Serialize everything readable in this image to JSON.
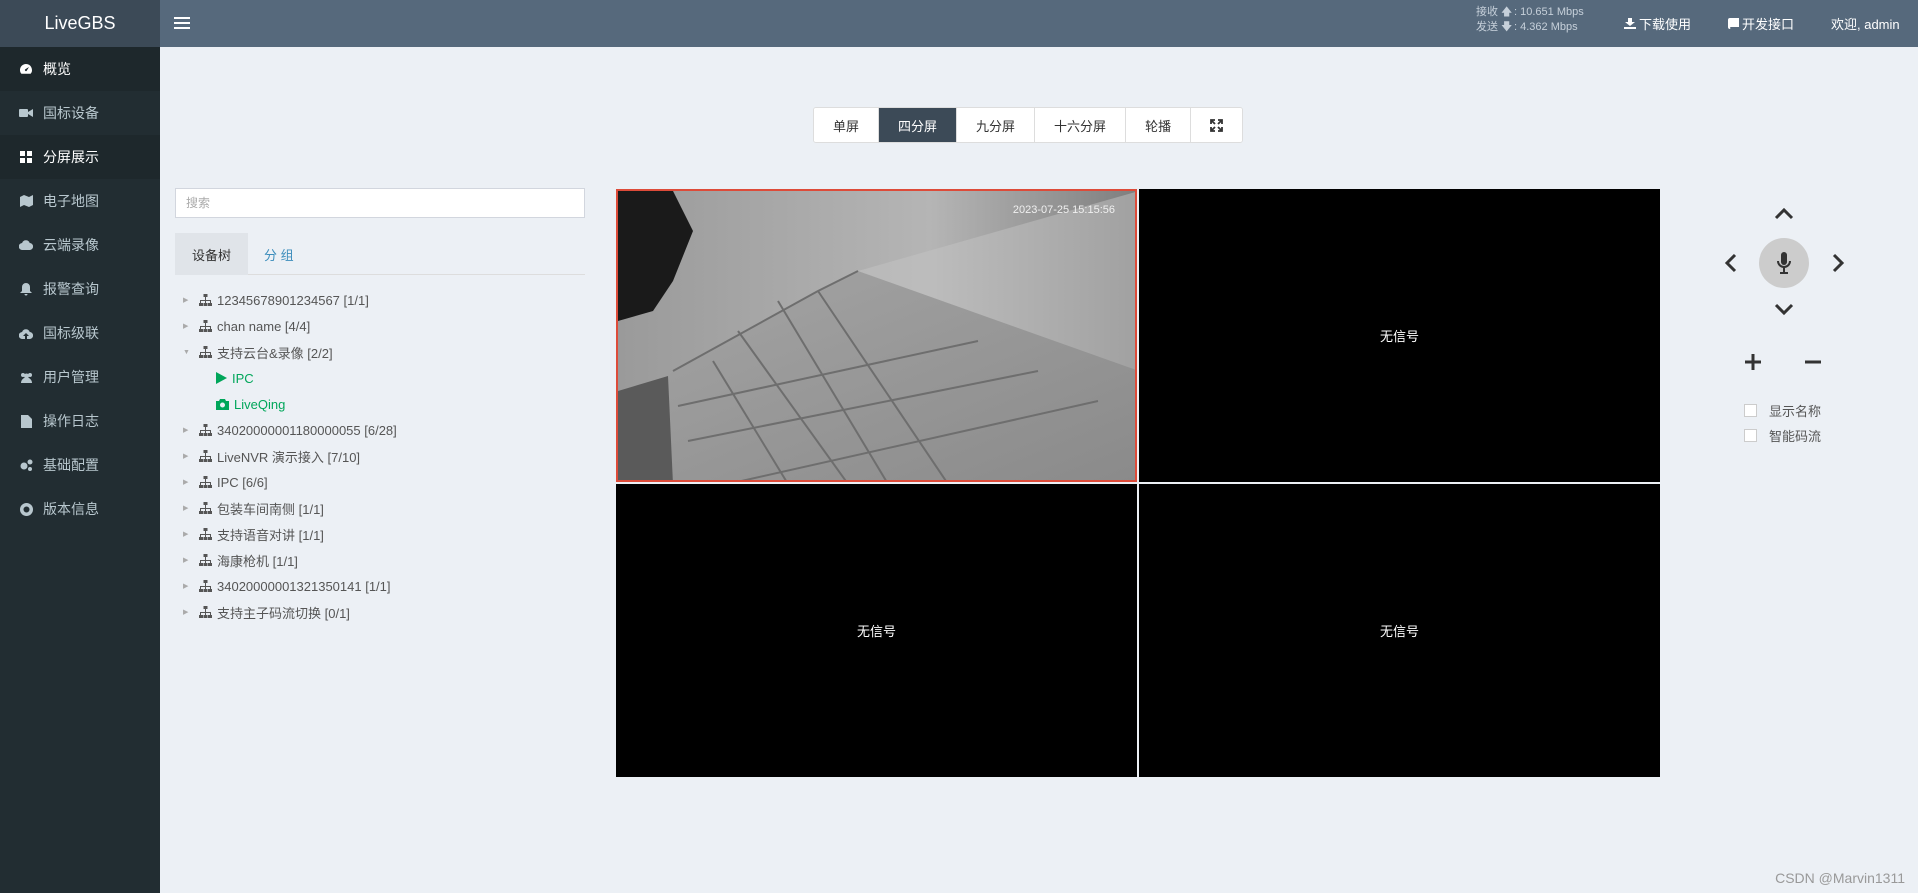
{
  "app": {
    "title": "LiveGBS"
  },
  "sidebar": {
    "items": [
      {
        "label": "概览",
        "icon": "dashboard-icon"
      },
      {
        "label": "国标设备",
        "icon": "video-camera-icon"
      },
      {
        "label": "分屏展示",
        "icon": "grid-icon"
      },
      {
        "label": "电子地图",
        "icon": "map-icon"
      },
      {
        "label": "云端录像",
        "icon": "cloud-icon"
      },
      {
        "label": "报警查询",
        "icon": "bell-icon"
      },
      {
        "label": "国标级联",
        "icon": "cloud-upload-icon"
      },
      {
        "label": "用户管理",
        "icon": "users-icon"
      },
      {
        "label": "操作日志",
        "icon": "file-icon"
      },
      {
        "label": "基础配置",
        "icon": "cogs-icon"
      },
      {
        "label": "版本信息",
        "icon": "life-ring-icon"
      }
    ]
  },
  "header": {
    "recv_label": "接收",
    "recv_value": "10.651 Mbps",
    "send_label": "发送",
    "send_value": "4.362 Mbps",
    "download": "下载使用",
    "api": "开发接口",
    "welcome": "欢迎, admin"
  },
  "split": {
    "buttons": [
      "单屏",
      "四分屏",
      "九分屏",
      "十六分屏",
      "轮播"
    ],
    "active": "四分屏"
  },
  "search": {
    "placeholder": "搜索"
  },
  "tabs": {
    "device_tree": "设备树",
    "group": "分 组"
  },
  "tree": {
    "nodes": [
      {
        "label": "12345678901234567 [1/1]"
      },
      {
        "label": "chan name [4/4]"
      },
      {
        "label": "支持云台&录像 [2/2]",
        "expanded": true,
        "children": [
          "IPC",
          "LiveQing"
        ]
      },
      {
        "label": "34020000001180000055 [6/28]"
      },
      {
        "label": "LiveNVR 演示接入 [7/10]"
      },
      {
        "label": "IPC [6/6]"
      },
      {
        "label": "包装车间南侧 [1/1]"
      },
      {
        "label": "支持语音对讲 [1/1]"
      },
      {
        "label": "海康枪机 [1/1]"
      },
      {
        "label": "34020000001321350141 [1/1]"
      },
      {
        "label": "支持主子码流切换 [0/1]"
      }
    ]
  },
  "video": {
    "timestamp": "2023-07-25 15:15:56",
    "no_signal": "无信号"
  },
  "ptz": {
    "show_name": "显示名称",
    "smart_stream": "智能码流"
  },
  "watermark": "CSDN @Marvin1311",
  "colors": {
    "sidebar": "#222d32",
    "header": "#56697c",
    "active_split": "#3c4a57",
    "selected_border": "#dd4b39",
    "tree_child": "#00a65a"
  }
}
